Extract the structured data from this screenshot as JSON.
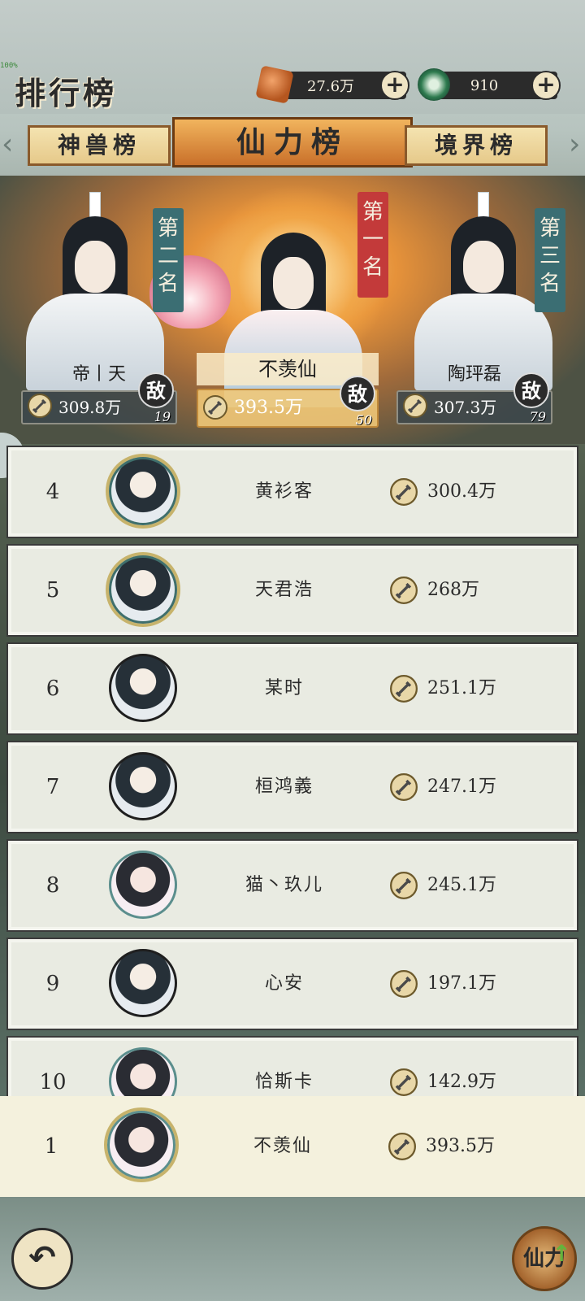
{
  "header": {
    "title": "排行榜",
    "debug_label": "100%"
  },
  "resources": [
    {
      "icon": "spirit-stone-icon",
      "value": "27.6万"
    },
    {
      "icon": "jade-coin-icon",
      "value": "910"
    }
  ],
  "tabs": [
    {
      "label": "神兽榜",
      "active": false
    },
    {
      "label": "仙力榜",
      "active": true
    },
    {
      "label": "境界榜",
      "active": false
    }
  ],
  "podium": {
    "second": {
      "banner": "第二名",
      "name": "帝丨天",
      "power": "309.8万",
      "foe": "敌",
      "level": "19"
    },
    "first": {
      "banner": "第一名",
      "name": "不羡仙",
      "power": "393.5万",
      "foe": "敌",
      "level": "50"
    },
    "third": {
      "banner": "第三名",
      "name": "陶玶磊",
      "power": "307.3万",
      "foe": "敌",
      "level": "79"
    }
  },
  "rankings": [
    {
      "rank": "4",
      "name": "黄衫客",
      "power": "300.4万",
      "avatar": "male-ornate"
    },
    {
      "rank": "5",
      "name": "天君浩",
      "power": "268万",
      "avatar": "male-ornate"
    },
    {
      "rank": "6",
      "name": "某时",
      "power": "251.1万",
      "avatar": "male"
    },
    {
      "rank": "7",
      "name": "桓鸿義",
      "power": "247.1万",
      "avatar": "male"
    },
    {
      "rank": "8",
      "name": "猫丶玖儿",
      "power": "245.1万",
      "avatar": "female"
    },
    {
      "rank": "9",
      "name": "心安",
      "power": "197.1万",
      "avatar": "male"
    },
    {
      "rank": "10",
      "name": "恰斯卡",
      "power": "142.9万",
      "avatar": "female"
    }
  ],
  "my_rank": {
    "rank": "1",
    "name": "不羡仙",
    "power": "393.5万"
  },
  "bottom": {
    "back_icon": "back-arrow-icon",
    "xianli_label": "仙力",
    "xianli_up": "↑"
  },
  "colors": {
    "accent": "#c9702a",
    "banner_red": "#c33a3a",
    "banner_teal": "#3b6e73",
    "row_bg": "#e9ebe2"
  }
}
